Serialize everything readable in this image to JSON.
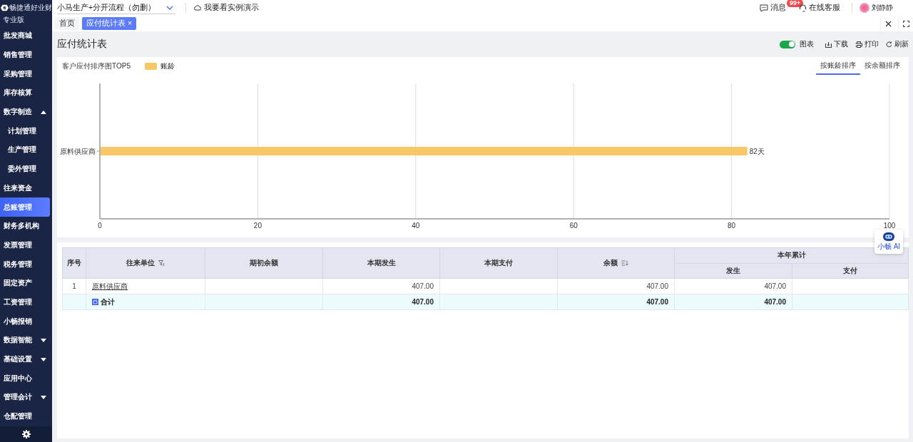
{
  "logo": {
    "name": "畅捷通好业财",
    "edition": "专业版"
  },
  "header": {
    "company_select": "小马生产+分开流程（勿删）",
    "demo_link": "我要看实例演示",
    "messages": "消息",
    "message_badge": "99+",
    "service": "在线客服",
    "user": "刘静静"
  },
  "sidebar": {
    "items": [
      {
        "label": "批发商城",
        "selected": false
      },
      {
        "label": "销售管理",
        "selected": false
      },
      {
        "label": "采购管理",
        "selected": false
      },
      {
        "label": "库存核算",
        "selected": false
      },
      {
        "label": "数字制造",
        "selected": false,
        "expanded": true,
        "children": [
          {
            "label": "计划管理",
            "selected": false
          },
          {
            "label": "生产管理",
            "selected": false
          },
          {
            "label": "委外管理",
            "selected": false
          }
        ]
      },
      {
        "label": "往来资金",
        "selected": false
      },
      {
        "label": "总账管理",
        "selected": true
      },
      {
        "label": "财务多机构",
        "selected": false
      },
      {
        "label": "发票管理",
        "selected": false
      },
      {
        "label": "税务管理",
        "selected": false
      },
      {
        "label": "固定资产",
        "selected": false
      },
      {
        "label": "工资管理",
        "selected": false
      },
      {
        "label": "小畅报销",
        "selected": false
      },
      {
        "label": "数据智能",
        "selected": false,
        "expanded": false
      },
      {
        "label": "基础设置",
        "selected": false,
        "expanded": false
      },
      {
        "label": "应用中心",
        "selected": false
      },
      {
        "label": "管理会计",
        "selected": false,
        "expanded": false
      },
      {
        "label": "仓配管理",
        "selected": false
      }
    ]
  },
  "tabs": [
    {
      "label": "首页",
      "selected": false
    },
    {
      "label": "应付统计表",
      "selected": true,
      "close": "×"
    }
  ],
  "page": {
    "title": "应付统计表",
    "chart_toggle": {
      "label": "图表",
      "on": true
    },
    "actions": [
      {
        "kind": "download",
        "label": "下载"
      },
      {
        "kind": "print",
        "label": "打印"
      },
      {
        "kind": "refresh",
        "label": "刷新"
      }
    ]
  },
  "chart_panel": {
    "title": "客户应付排序图TOP5",
    "sort_tabs": [
      {
        "label": "按账龄排序",
        "selected": true
      },
      {
        "label": "按余额排序",
        "selected": false
      }
    ],
    "chart_data": {
      "type": "bar",
      "orientation": "horizontal",
      "categories": [
        "原料供应商"
      ],
      "series": [
        {
          "name": "账龄",
          "color": "#f8c766",
          "values": [
            82
          ]
        }
      ],
      "grid": true,
      "xlim": [
        0,
        100
      ],
      "xticks": [
        0,
        20,
        40,
        60,
        80,
        100
      ],
      "value_labels": [
        "82天"
      ]
    }
  },
  "ai_button": {
    "label": "小畅 AI"
  },
  "table": {
    "columns": [
      {
        "label": "序号",
        "kind": "plain"
      },
      {
        "label": "往来单位",
        "kind": "filter"
      },
      {
        "label": "期初余额",
        "kind": "plain"
      },
      {
        "label": "本期发生",
        "kind": "plain"
      },
      {
        "label": "本期支付",
        "kind": "plain"
      },
      {
        "label": "余额",
        "kind": "sort"
      }
    ],
    "group": {
      "label": "本年累计",
      "children": [
        {
          "label": "发生"
        },
        {
          "label": "支付"
        }
      ]
    },
    "rows": [
      {
        "kind": "data",
        "cells": [
          "1",
          "原料供应商",
          "",
          "407.00",
          "",
          "407.00",
          "407.00",
          ""
        ]
      },
      {
        "kind": "total",
        "cells": [
          "",
          "合计",
          "",
          "407.00",
          "",
          "407.00",
          "407.00",
          ""
        ]
      }
    ]
  }
}
